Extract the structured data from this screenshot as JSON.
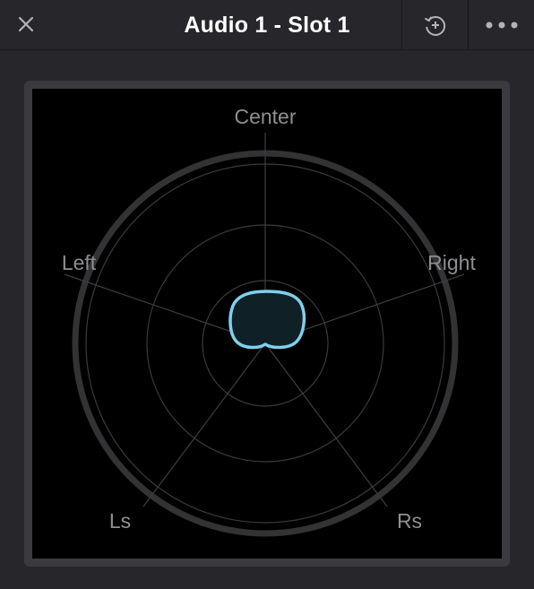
{
  "header": {
    "title": "Audio 1 - Slot 1",
    "close_icon": "close-icon",
    "reset_icon": "reset-add-icon",
    "more_icon": "more-horizontal-icon"
  },
  "scope": {
    "channels": {
      "center": "Center",
      "left": "Left",
      "right": "Right",
      "ls": "Ls",
      "rs": "Rs"
    },
    "colors": {
      "background": "#000000",
      "grid": "#3a3a3e",
      "outer_ring": "#333336",
      "label": "#8e8e92",
      "trace": "#7fd0ec",
      "trace_fill": "#0f2126"
    }
  }
}
